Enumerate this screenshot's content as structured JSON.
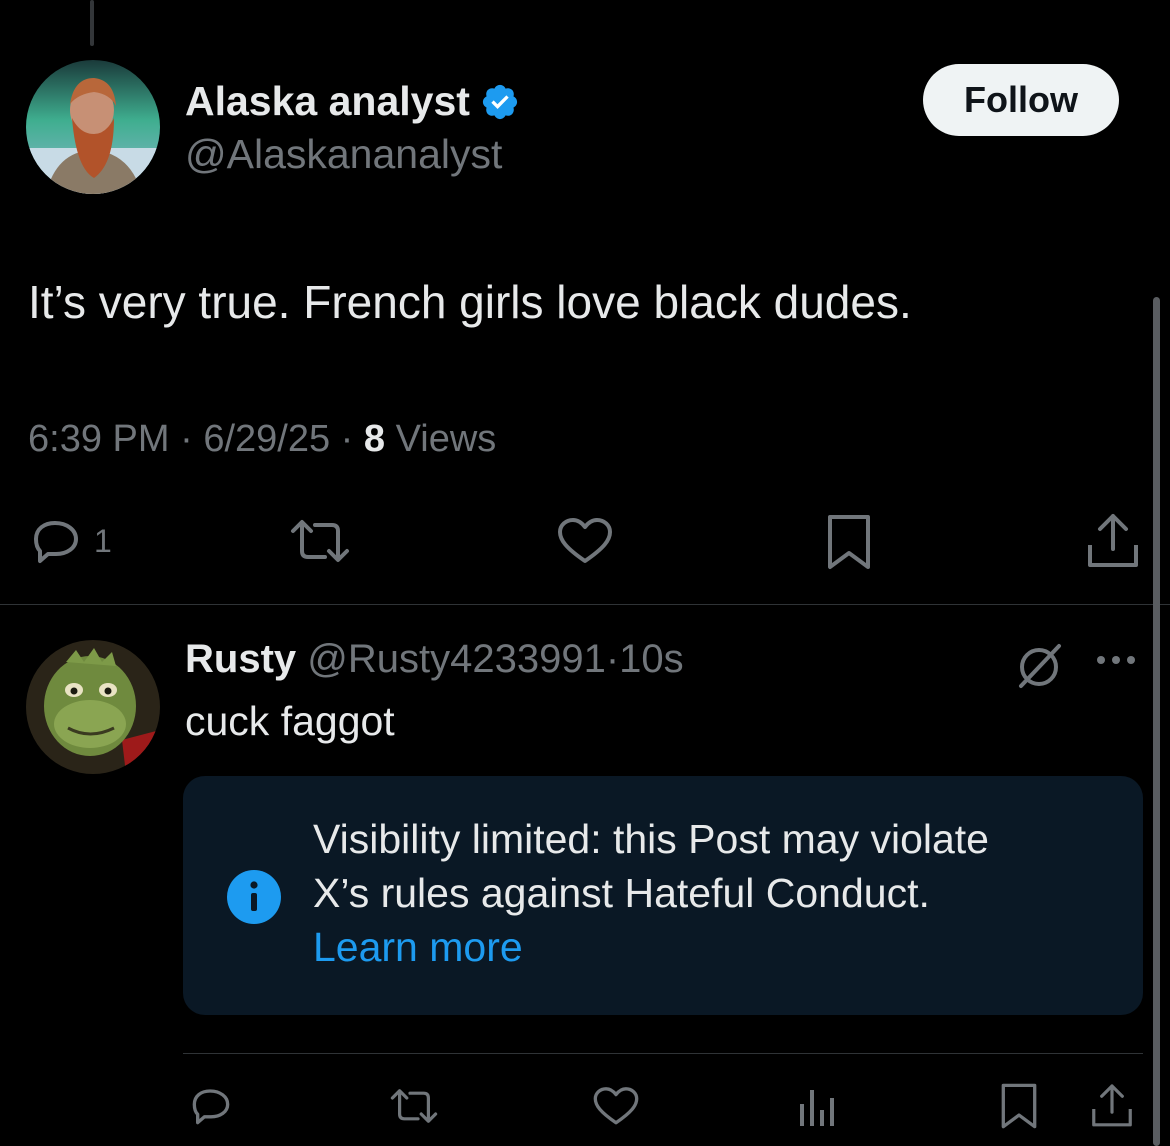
{
  "post": {
    "author_name": "Alaska analyst",
    "author_handle": "@Alaskananalyst",
    "follow_label": "Follow",
    "text": "It’s very true. French girls love black dudes.",
    "time": "6:39 PM",
    "separator": "·",
    "date": "6/29/25",
    "views_count": "8",
    "views_label": "Views",
    "reply_count": "1"
  },
  "reply": {
    "author_name": "Rusty",
    "author_handle": "@Rusty4233991",
    "separator": "·",
    "time": "10s",
    "text": "cuck faggot",
    "notice": {
      "line1": "Visibility limited: this Post may violate",
      "line2": "X’s rules against Hateful Conduct.",
      "link": "Learn more"
    }
  },
  "colors": {
    "background": "#000000",
    "text_primary": "#e7e9ea",
    "text_secondary": "#71767b",
    "accent_blue": "#1d9bf0",
    "notice_background": "#0a1825",
    "divider": "#2f3336"
  },
  "icons": {
    "verified": "verified-badge-icon",
    "reply": "reply-icon",
    "repost": "repost-icon",
    "like": "heart-icon",
    "bookmark": "bookmark-icon",
    "share": "share-icon",
    "analytics": "analytics-icon",
    "limited": "limited-visibility-icon",
    "more": "more-options-icon",
    "info": "info-icon"
  }
}
